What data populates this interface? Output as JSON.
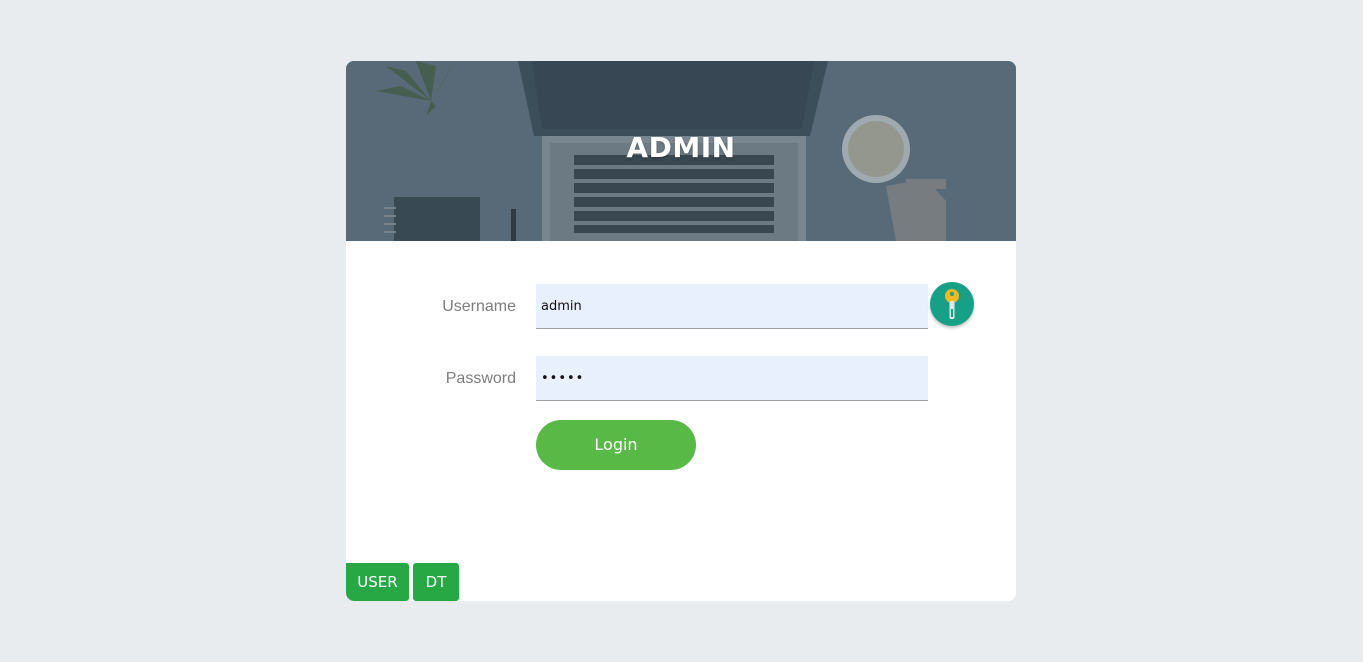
{
  "hero": {
    "title": "ADMIN"
  },
  "form": {
    "username_label": "Username",
    "username_value": "admin",
    "password_label": "Password",
    "password_value": "•••••",
    "login_label": "Login"
  },
  "tabs": [
    {
      "label": "USER"
    },
    {
      "label": "DT"
    }
  ],
  "icons": {
    "key_button": "key-icon"
  },
  "colors": {
    "background": "#e8ecee",
    "login_button": "#58b946",
    "tab_button": "#28a745",
    "key_button": "#16a086",
    "input_fill": "#e8f0fe"
  }
}
